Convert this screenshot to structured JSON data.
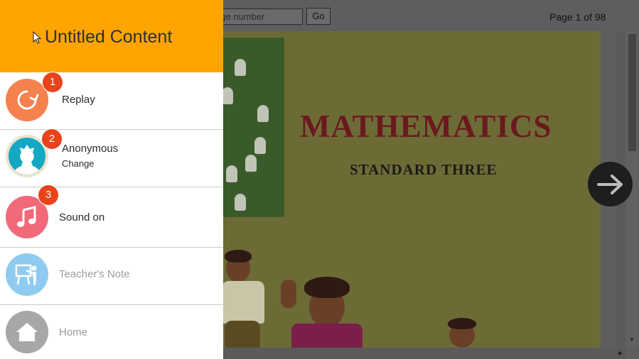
{
  "viewer": {
    "page_input_placeholder": "age number",
    "go_label": "Go",
    "page_indicator": "Page 1 of 98",
    "book_title": "MATHEMATICS",
    "book_subtitle": "STANDARD THREE"
  },
  "menu": {
    "title": "Untitled Content",
    "accent_color": "#ffa401",
    "items": [
      {
        "label": "Replay",
        "badge": "1",
        "icon": "replay-icon",
        "color": "#f5814e"
      },
      {
        "label": "Anonymous",
        "sublabel": "Change",
        "badge": "2",
        "icon": "user-avatar-icon",
        "color": "#14a8c4"
      },
      {
        "label": "Sound on",
        "badge": "3",
        "icon": "music-note-icon",
        "color": "#f06a7a"
      },
      {
        "label": "Teacher's Note",
        "icon": "teacher-board-icon",
        "color": "#8fcbef"
      },
      {
        "label": "Home",
        "icon": "home-icon",
        "color": "#a7a7a7"
      }
    ]
  },
  "badge_color": "#e8431a"
}
